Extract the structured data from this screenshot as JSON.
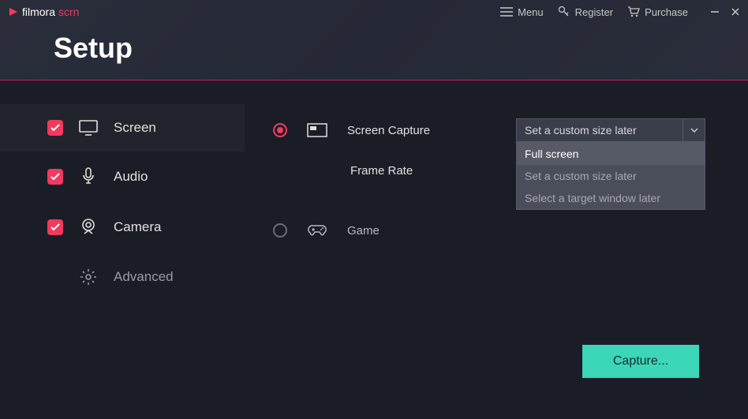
{
  "brand": {
    "name": "filmora",
    "suffix": "scrn"
  },
  "titlebar": {
    "menu": "Menu",
    "register": "Register",
    "purchase": "Purchase"
  },
  "page_title": "Setup",
  "sidebar": {
    "items": [
      {
        "label": "Screen",
        "checked": true
      },
      {
        "label": "Audio",
        "checked": true
      },
      {
        "label": "Camera",
        "checked": true
      },
      {
        "label": "Advanced",
        "checked": false
      }
    ]
  },
  "content": {
    "screen_capture": {
      "label": "Screen Capture",
      "selected": true,
      "size_select": {
        "value": "Set a custom size later",
        "options": [
          "Full screen",
          "Set a custom size later",
          "Select a target window later"
        ]
      }
    },
    "frame_rate": {
      "label": "Frame Rate"
    },
    "game": {
      "label": "Game",
      "selected": false
    }
  },
  "capture_button": "Capture...",
  "colors": {
    "accent_pink": "#f03a5f",
    "accent_teal": "#3cd6b9",
    "bg": "#1a1d26"
  }
}
